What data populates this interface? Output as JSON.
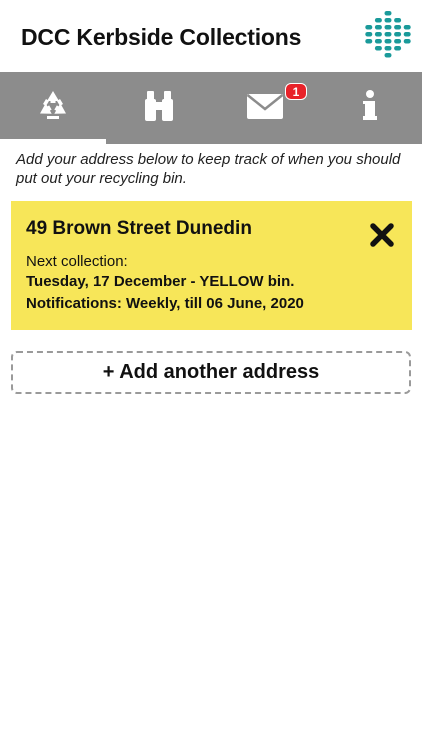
{
  "header": {
    "title": "DCC Kerbside Collections",
    "logo_icon": "dcc-logo-icon"
  },
  "tabs": [
    {
      "icon": "recycle-icon",
      "active": true
    },
    {
      "icon": "binoculars-icon",
      "active": false
    },
    {
      "icon": "mail-icon",
      "active": false,
      "badge": "1"
    },
    {
      "icon": "info-icon",
      "active": false
    }
  ],
  "intro": "Add your address below to keep track of when you should put out your recycling bin.",
  "address_card": {
    "address": "49 Brown Street Dunedin",
    "next_label": "Next collection:",
    "next_value": "Tuesday, 17 December - YELLOW bin.",
    "notifications": "Notifications: Weekly, till 06 June, 2020",
    "remove_icon": "close-icon"
  },
  "add_button": {
    "label": "+ Add another address"
  },
  "colors": {
    "tabbar": "#8c8c8c",
    "card": "#f7e659",
    "badge": "#e8222a",
    "logo": "#1a9a9a"
  }
}
